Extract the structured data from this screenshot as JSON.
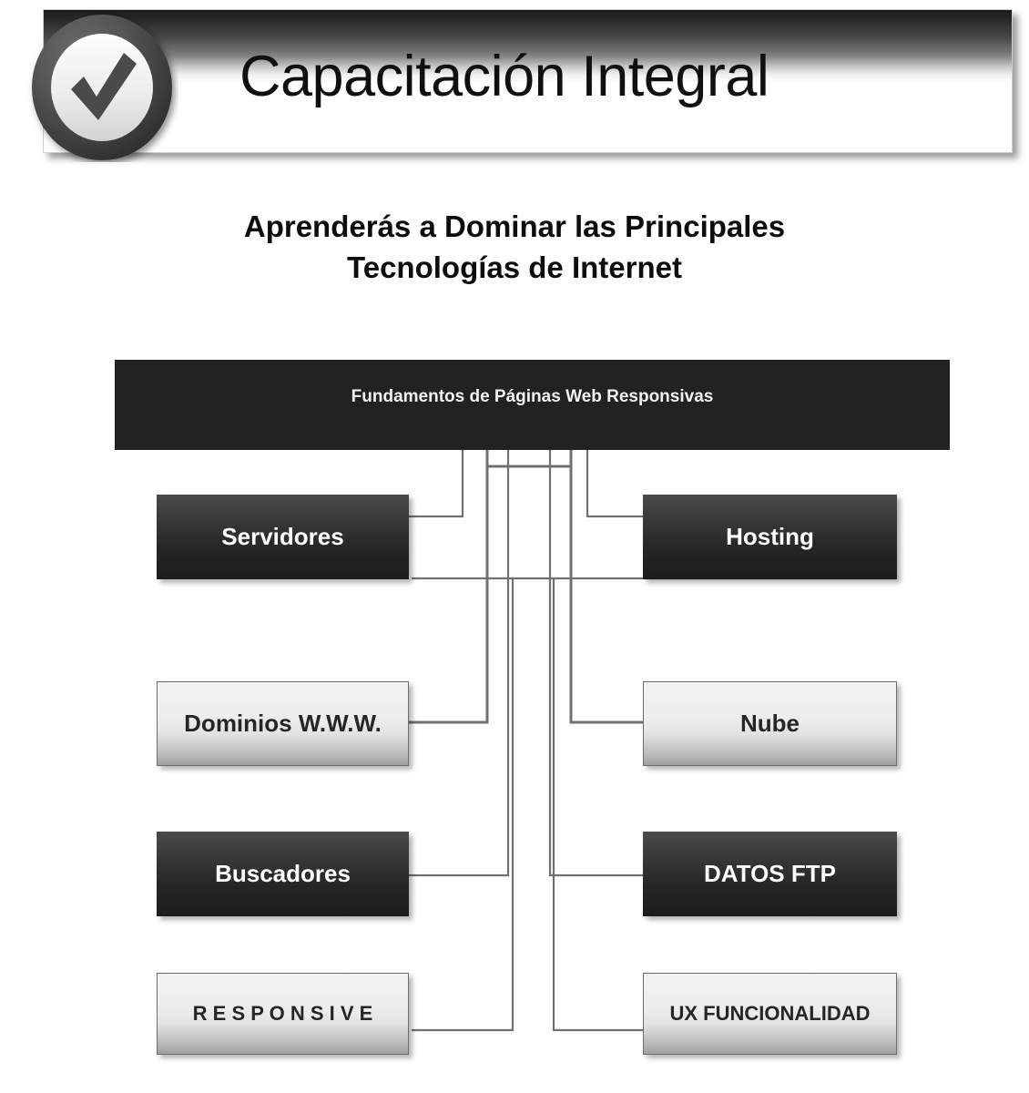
{
  "header": {
    "title": "Capacitación Integral",
    "badge_icon": "check-circle-icon"
  },
  "subtitle": {
    "line1": "Aprenderás a Dominar las Principales",
    "line2": "Tecnologías de Internet"
  },
  "diagram": {
    "root": {
      "label": "Fundamentos  de Páginas Web Responsivas",
      "style": "dark"
    },
    "nodes_left": [
      {
        "label": "Servidores",
        "style": "dark"
      },
      {
        "label": "Dominios W.W.W.",
        "style": "light"
      },
      {
        "label": "Buscadores",
        "style": "dark"
      },
      {
        "label": "R E S P O N S I V E",
        "style": "light"
      }
    ],
    "nodes_right": [
      {
        "label": "Hosting",
        "style": "dark"
      },
      {
        "label": "Nube",
        "style": "light"
      },
      {
        "label": "DATOS FTP",
        "style": "dark"
      },
      {
        "label": "UX FUNCIONALIDAD",
        "style": "light"
      }
    ],
    "connector_color": "#707070"
  },
  "colors": {
    "dark_box": "#222222",
    "light_box": "#e8e8e8",
    "text_light": "#ffffff",
    "text_dark": "#1a1a1a",
    "connector": "#707070",
    "background": "#ffffff"
  }
}
